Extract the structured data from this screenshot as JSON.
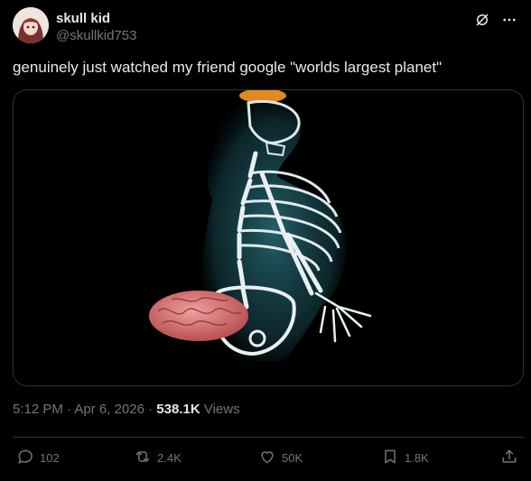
{
  "author": {
    "display_name": "skull kid",
    "handle": "@skullkid753"
  },
  "post": {
    "text": "genuinely just watched my friend google \"worlds largest planet\""
  },
  "meta": {
    "time": "5:12 PM",
    "separator": " · ",
    "date": "Apr 6, 2026",
    "separator2": " · ",
    "views_count": "538.1K",
    "views_label": " Views"
  },
  "actions": {
    "replies": "102",
    "reposts": "2.4K",
    "likes": "50K",
    "bookmarks": "1.8K"
  },
  "icons": [
    "grok-icon",
    "more-icon",
    "reply-icon",
    "repost-icon",
    "like-icon",
    "bookmark-icon",
    "share-icon"
  ],
  "colors": {
    "background": "#000000",
    "text": "#e7e9ea",
    "secondary": "#71767b",
    "border": "#2f3336"
  }
}
